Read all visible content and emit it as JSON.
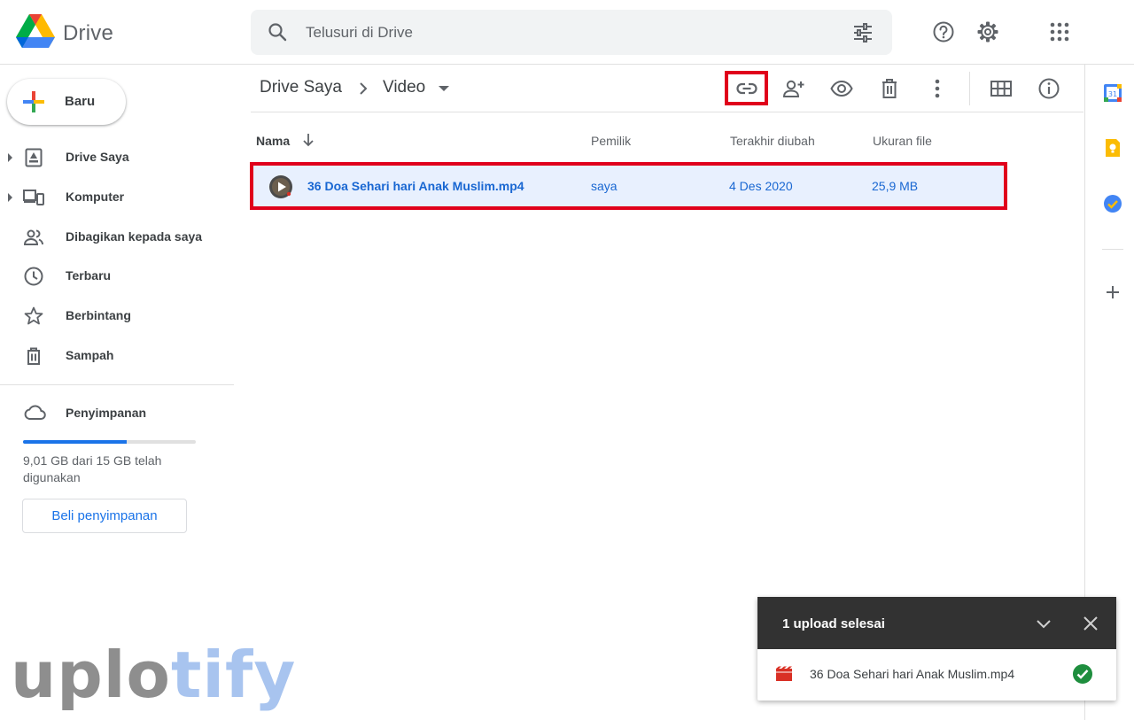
{
  "header": {
    "brand": "Drive",
    "search_placeholder": "Telusuri di Drive",
    "icons": [
      "help-icon",
      "settings-icon",
      "apps-grid-icon"
    ]
  },
  "sidebar": {
    "new_label": "Baru",
    "items": [
      {
        "label": "Drive Saya",
        "icon": "my-drive-icon",
        "expandable": true
      },
      {
        "label": "Komputer",
        "icon": "computer-icon",
        "expandable": true
      },
      {
        "label": "Dibagikan kepada saya",
        "icon": "shared-icon",
        "expandable": false
      },
      {
        "label": "Terbaru",
        "icon": "clock-icon",
        "expandable": false
      },
      {
        "label": "Berbintang",
        "icon": "star-icon",
        "expandable": false
      },
      {
        "label": "Sampah",
        "icon": "trash-icon",
        "expandable": false
      }
    ],
    "storage": {
      "label": "Penyimpanan",
      "used_text": "9,01 GB dari 15 GB telah digunakan",
      "used_fraction": 0.6,
      "buy_label": "Beli penyimpanan"
    }
  },
  "toolbar": {
    "breadcrumb": [
      "Drive Saya",
      "Video"
    ],
    "icons": [
      "link-icon",
      "add-person-icon",
      "preview-eye-icon",
      "delete-icon",
      "more-vert-icon",
      "grid-view-icon",
      "info-icon"
    ]
  },
  "table": {
    "columns": [
      "Nama",
      "Pemilik",
      "Terakhir diubah",
      "Ukuran file"
    ],
    "rows": [
      {
        "name": "36 Doa Sehari hari Anak Muslim.mp4",
        "owner": "saya",
        "modified": "4 Des 2020",
        "size": "25,9 MB"
      }
    ]
  },
  "upload_panel": {
    "title": "1 upload selesai",
    "file": "36 Doa Sehari hari Anak Muslim.mp4"
  },
  "watermark": {
    "part1": "uplo",
    "part2": "tify"
  },
  "colors": {
    "accent": "#1a73e8",
    "highlight": "#e0001b",
    "selected_row": "#e8f0fe",
    "success": "#1e8e3e"
  }
}
